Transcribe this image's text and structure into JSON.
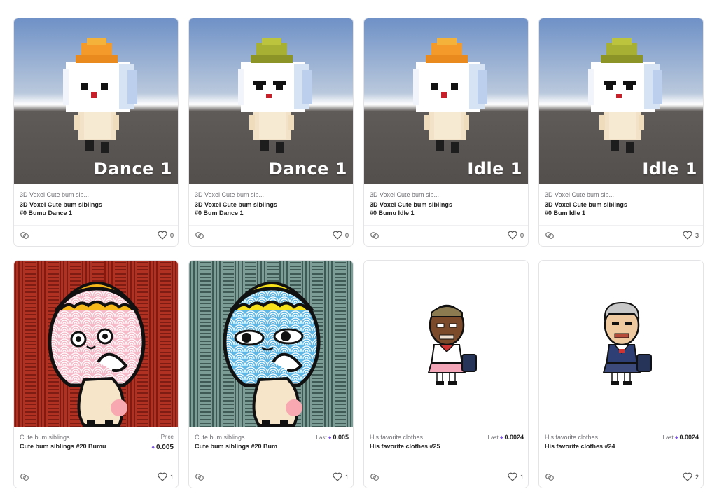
{
  "cards": [
    {
      "collection": "3D Voxel Cute bum sib...",
      "title_line1": "3D Voxel Cute bum siblings",
      "title_line2": "#0 Bumu Dance 1",
      "overlay": "Dance 1",
      "favorites": "0"
    },
    {
      "collection": "3D Voxel Cute bum sib...",
      "title_line1": "3D Voxel Cute bum siblings",
      "title_line2": "#0 Bum Dance 1",
      "overlay": "Dance 1",
      "favorites": "0"
    },
    {
      "collection": "3D Voxel Cute bum sib...",
      "title_line1": "3D Voxel Cute bum siblings",
      "title_line2": "#0 Bumu Idle 1",
      "overlay": "Idle 1",
      "favorites": "0"
    },
    {
      "collection": "3D Voxel Cute bum sib...",
      "title_line1": "3D Voxel Cute bum siblings",
      "title_line2": "#0 Bum Idle 1",
      "overlay": "Idle 1",
      "favorites": "3"
    },
    {
      "collection": "Cute bum siblings",
      "title": "Cute bum siblings #20 Bumu",
      "price_label": "Price",
      "price": "0.005",
      "favorites": "1"
    },
    {
      "collection": "Cute bum siblings",
      "title": "Cute bum siblings #20 Bum",
      "price_label": "Last",
      "price": "0.005",
      "favorites": "1"
    },
    {
      "collection": "His favorite clothes",
      "title": "His favorite clothes #25",
      "price_label": "Last",
      "price": "0.0024",
      "favorites": "1"
    },
    {
      "collection": "His favorite clothes",
      "title": "His favorite clothes #24",
      "price_label": "Last",
      "price": "0.0024",
      "favorites": "2"
    }
  ],
  "icons": {
    "link": "link-icon",
    "favorite": "heart-icon",
    "currency": "ethereum-icon"
  },
  "colors": {
    "eth": "#7b52e6",
    "card_border": "#e4e4e6"
  }
}
